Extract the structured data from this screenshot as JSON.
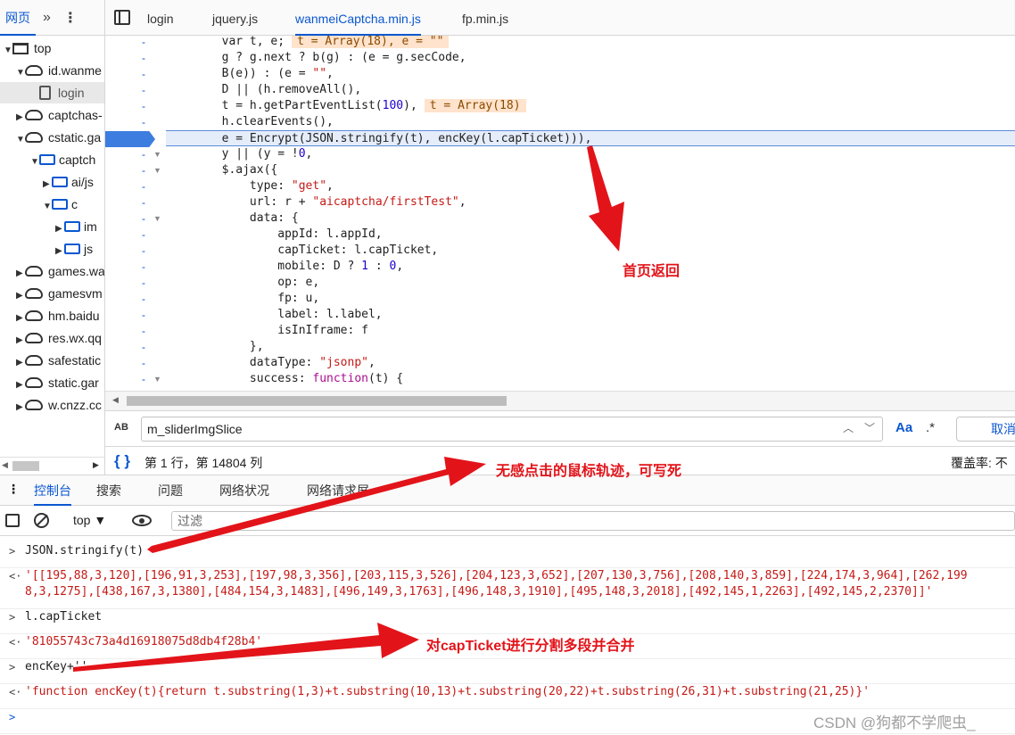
{
  "navigator": {
    "tab_label": "网页",
    "more_label": "»",
    "kebab_label": "⋮",
    "tree": [
      {
        "label": "top",
        "icon": "frame-icon",
        "indent": 0,
        "arrow": "▼"
      },
      {
        "label": "id.wanme",
        "icon": "cloud-icon",
        "indent": 1,
        "arrow": "▼"
      },
      {
        "label": "login",
        "icon": "file-icon",
        "indent": 2,
        "arrow": ""
      },
      {
        "label": "captchas-",
        "icon": "cloud-icon",
        "indent": 1,
        "arrow": "▶"
      },
      {
        "label": "cstatic.ga",
        "icon": "cloud-icon",
        "indent": 1,
        "arrow": "▼"
      },
      {
        "label": "captch",
        "icon": "folder-icon",
        "indent": 2,
        "arrow": "▼"
      },
      {
        "label": "ai/js",
        "icon": "folder-icon",
        "indent": 3,
        "arrow": "▶"
      },
      {
        "label": "c",
        "icon": "folder-icon",
        "indent": 3,
        "arrow": "▼"
      },
      {
        "label": "im",
        "icon": "folder-icon",
        "indent": 4,
        "arrow": "▶"
      },
      {
        "label": "js",
        "icon": "folder-icon",
        "indent": 4,
        "arrow": "▶"
      },
      {
        "label": "games.wa",
        "icon": "cloud-icon",
        "indent": 1,
        "arrow": "▶"
      },
      {
        "label": "gamesvm",
        "icon": "cloud-icon",
        "indent": 1,
        "arrow": "▶"
      },
      {
        "label": "hm.baidu",
        "icon": "cloud-icon",
        "indent": 1,
        "arrow": "▶"
      },
      {
        "label": "res.wx.qq",
        "icon": "cloud-icon",
        "indent": 1,
        "arrow": "▶"
      },
      {
        "label": "safestatic",
        "icon": "cloud-icon",
        "indent": 1,
        "arrow": "▶"
      },
      {
        "label": "static.gar",
        "icon": "cloud-icon",
        "indent": 1,
        "arrow": "▶"
      },
      {
        "label": "w.cnzz.cc",
        "icon": "cloud-icon",
        "indent": 1,
        "arrow": "▶"
      }
    ]
  },
  "editor": {
    "tabs": [
      {
        "label": "login",
        "active": false
      },
      {
        "label": "jquery.js",
        "active": false
      },
      {
        "label": "wanmeiCaptcha.min.js",
        "active": true
      },
      {
        "label": "fp.min.js",
        "active": false
      }
    ],
    "code_lines": [
      "var t, e;",
      "g ? g.next ? b(g) : (e = g.secCode,",
      "B(e)) : (e = \"\",",
      "D || (h.removeAll(),",
      "t = h.getPartEventList(100),",
      "h.clearEvents(),",
      "e = Encrypt(JSON.stringify(t), encKey(l.capTicket))),",
      "y || (y = !0,",
      "$.ajax({",
      "    type: \"get\",",
      "    url: r + \"aicaptcha/firstTest\",",
      "    data: {",
      "        appId: l.appId,",
      "        capTicket: l.capTicket,",
      "        mobile: D ? 1 : 0,",
      "        op: e,",
      "        fp: u,",
      "        label: l.label,",
      "        isInIframe: f",
      "    },",
      "    dataType: \"jsonp\",",
      "    success: function(t) {"
    ],
    "inline_value_1": "t = Array(18), e = \"\"",
    "inline_value_2": "t = Array(18)",
    "line_marker": "-",
    "find_query": "m_sliderImgSlice",
    "find_case_label": "Aa",
    "find_regex_label": ".*",
    "find_cancel_label": "取消",
    "find_ab_label": "AB",
    "status_position": "第 1 行，第 14804 列",
    "status_coverage": "覆盖率: 不",
    "braces_label": "{ }"
  },
  "drawer": {
    "tabs": [
      "控制台",
      "搜索",
      "问题",
      "网络状况",
      "网络请求屏"
    ],
    "context": "top ▼",
    "filter_placeholder": "过滤"
  },
  "console": {
    "lines": [
      {
        "prompt": ">",
        "text": "JSON.stringify(t)",
        "type": "input"
      },
      {
        "prompt": "<·",
        "text": "'[[195,88,3,120],[196,91,3,253],[197,98,3,356],[203,115,3,526],[204,123,3,652],[207,130,3,756],[208,140,3,859],[224,174,3,964],[262,199",
        "type": "result"
      },
      {
        "prompt": "",
        "text": "8,3,1275],[438,167,3,1380],[484,154,3,1483],[496,149,3,1763],[496,148,3,1910],[495,148,3,2018],[492,145,1,2263],[492,145,2,2370]]'",
        "type": "result"
      },
      {
        "prompt": ">",
        "text": "l.capTicket",
        "type": "input"
      },
      {
        "prompt": "<·",
        "text": "'81055743c73a4d16918075d8db4f28b4'",
        "type": "result"
      },
      {
        "prompt": ">",
        "text": "encKey+''",
        "type": "input"
      },
      {
        "prompt": "<·",
        "text": "'function encKey(t){return t.substring(1,3)+t.substring(10,13)+t.substring(20,22)+t.substring(26,31)+t.substring(21,25)}'",
        "type": "result"
      },
      {
        "prompt": ">",
        "text": "",
        "type": "input"
      }
    ]
  },
  "annotations": {
    "a1": "首页返回",
    "a2": "无感点击的鼠标轨迹，可写死",
    "a3": "对capTicket进行分割多段并合并"
  },
  "watermark": "CSDN @狗都不学爬虫_",
  "colors": {
    "accent": "#0b57d0",
    "annotation": "#e2141a",
    "string": "#c41a16"
  }
}
